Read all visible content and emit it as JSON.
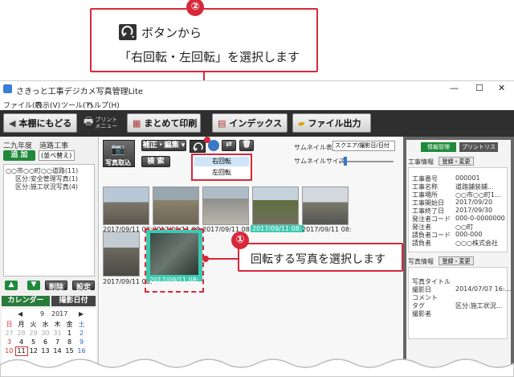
{
  "callout2": {
    "num": "②",
    "line1": "ボタンから",
    "line2": "「右回転・左回転」を選択します"
  },
  "callout1": {
    "num": "①",
    "text": "回転する写真を選択します"
  },
  "window": {
    "title": "さきっと工事デジカメ写真管理Lite",
    "menus": [
      "ファイル(F)",
      "表示(V)",
      "ツール(T)",
      "ヘルプ(H)"
    ],
    "controls": [
      "—",
      "☐",
      "✕"
    ]
  },
  "toolbar": {
    "back": "本棚にもどる",
    "print_menu": "プリント\nメニュー",
    "batch_print": "まとめて印刷",
    "index": "インデックス",
    "file_output": "ファイル出力"
  },
  "left": {
    "project": "二九年度　道路工事",
    "add": "追 加",
    "sort": "(並べ替え)",
    "tree": [
      "○○市○○町○○道路(11)",
      "区分:安全管理写真(1)",
      "区分:施工状況写真(4)"
    ],
    "delete": "削除",
    "settings": "設定",
    "calendar_tab": "カレンダー",
    "date_tab": "撮影日付",
    "month": "9",
    "year": "2017",
    "weekdays": [
      "日",
      "月",
      "火",
      "水",
      "木",
      "金",
      "土"
    ],
    "week1": [
      "27",
      "28",
      "29",
      "30",
      "31",
      "1",
      "2"
    ],
    "week2": [
      "3",
      "4",
      "5",
      "6",
      "7",
      "8",
      "9"
    ],
    "week3": [
      "10",
      "11",
      "12",
      "13",
      "14",
      "15",
      "16"
    ]
  },
  "mid": {
    "import": "写真取込",
    "edit": "補正・編集",
    "search": "検 索",
    "thumb_display_label": "サムネイル表示",
    "thumb_display_value": "スクエア/撮影日/日付",
    "thumb_size_label": "サムネイルサイズ",
    "menu_rotate_right": "右回転",
    "menu_rotate_left": "左回転",
    "captions": [
      "2017/09/11 08:..",
      "2017/09/11 08:",
      "2017/09/11 08:",
      "2017/09/11 08:",
      "2017/09/11 08:"
    ],
    "captions_row2": [
      "2017/09/11 08:",
      "2017/09/11 08:"
    ]
  },
  "right": {
    "tab_info": "情報管理",
    "tab_print": "プリントリスト",
    "section1": "工事情報",
    "edit1": "登録・変更",
    "rows1": [
      {
        "k": "工事番号",
        "v": "000001"
      },
      {
        "k": "工事名称",
        "v": "道路舗装鋪..."
      },
      {
        "k": "工事場所",
        "v": "○○市○○町1..."
      },
      {
        "k": "工事開始日",
        "v": "2017/09/20"
      },
      {
        "k": "工事終了日",
        "v": "2017/09/30"
      },
      {
        "k": "発注者コード",
        "v": "000-0-0000000"
      },
      {
        "k": "発注者",
        "v": "○○町"
      },
      {
        "k": "請負者コード",
        "v": "000-000"
      },
      {
        "k": "請負者",
        "v": "○○○株式会社"
      }
    ],
    "section2": "写真情報",
    "edit2": "登録・変更",
    "rows2": [
      {
        "k": "写真タイトル",
        "v": ""
      },
      {
        "k": "撮影日",
        "v": "2014/07/07 16:..."
      },
      {
        "k": "コメント",
        "v": ""
      },
      {
        "k": "タグ",
        "v": "区分:施工状況..."
      },
      {
        "k": "撮影者",
        "v": ""
      }
    ]
  },
  "colors": {
    "accent": "#d7283a",
    "selection": "#3cc9b0",
    "toolbar": "#2f2f2f"
  }
}
